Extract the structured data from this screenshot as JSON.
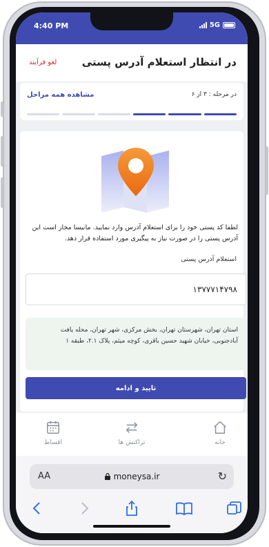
{
  "status": {
    "time": "4:40 PM",
    "network": "5G"
  },
  "header": {
    "title": "در انتظار استعلام آدرس پستی",
    "cancel_label": "لغو فرآیند"
  },
  "steps": {
    "current_label": "در مرحله : ۳ از ۶",
    "view_all_label": "مشاهده همه مراحل",
    "total": 6,
    "current": 3
  },
  "main": {
    "illustration_icon": "map-pin-icon",
    "description": "لطفا کد پستی خود را برای استعلام آدرس وارد نمایید. مانیسا مجاز است این آدرس پستی را در صورت نیاز به پیگیری مورد استفاده قرار دهد.",
    "field_label": "استعلام آدرس پستی",
    "postal_code_value": "۱۳۷۷۷۱۴۷۹۸",
    "address_result": "استان تهران، شهرستان تهران، بخش مرکزی، شهر تهران، محله یافت آبادجنوبی، خیابان شهید حسین باقری، کوچه میثم، پلاک ۲.۱، طبقه ۱",
    "confirm_label": "تایید و ادامه"
  },
  "nav": {
    "items": [
      {
        "label": "خانه",
        "icon": "home-icon"
      },
      {
        "label": "تراکنش ها",
        "icon": "transfer-icon"
      },
      {
        "label": "اقساط",
        "icon": "calendar-icon"
      }
    ]
  },
  "browser": {
    "aa_label": "AA",
    "url": "moneysa.ir",
    "icons": [
      "back-icon",
      "forward-icon",
      "share-icon",
      "bookmarks-icon",
      "tabs-icon"
    ]
  },
  "colors": {
    "primary": "#3f4bb0",
    "danger": "#d6282f",
    "address_bg": "#edf5ee",
    "pin": "#f07d20"
  }
}
